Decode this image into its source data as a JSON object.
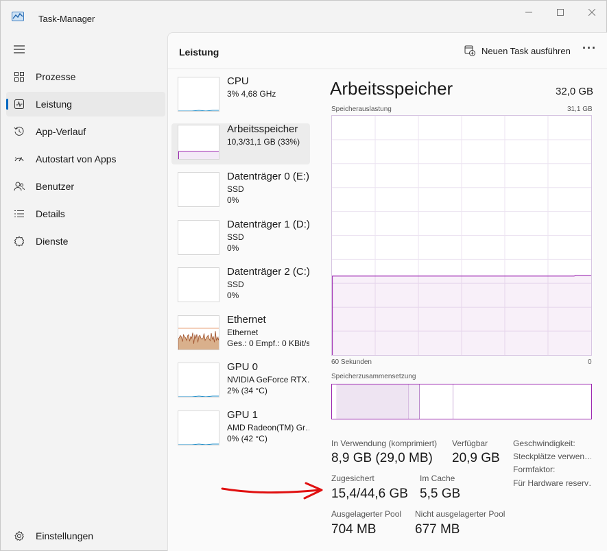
{
  "window": {
    "title": "Task-Manager"
  },
  "sidebar": {
    "items": [
      {
        "label": "Prozesse",
        "icon": "processes-icon"
      },
      {
        "label": "Leistung",
        "icon": "performance-icon",
        "active": true
      },
      {
        "label": "App-Verlauf",
        "icon": "history-icon"
      },
      {
        "label": "Autostart von Apps",
        "icon": "startup-icon"
      },
      {
        "label": "Benutzer",
        "icon": "users-icon"
      },
      {
        "label": "Details",
        "icon": "details-icon"
      },
      {
        "label": "Dienste",
        "icon": "services-icon"
      }
    ],
    "settings": {
      "label": "Einstellungen",
      "icon": "gear-icon"
    }
  },
  "header": {
    "title": "Leistung",
    "run_task": "Neuen Task ausführen",
    "more": "···"
  },
  "devices": [
    {
      "name": "CPU",
      "sub1": "3%  4,68 GHz",
      "sub2": "",
      "graph": "cpu",
      "color": "#1b8bc7"
    },
    {
      "name": "Arbeitsspeicher",
      "sub1": "10,3/31,1 GB (33%)",
      "sub2": "",
      "graph": "memory",
      "color": "#9c27b0",
      "active": true
    },
    {
      "name": "Datenträger 0 (E:)",
      "sub1": "SSD",
      "sub2": "0%",
      "graph": "disk",
      "color": "#4caf50"
    },
    {
      "name": "Datenträger 1 (D:)",
      "sub1": "SSD",
      "sub2": "0%",
      "graph": "disk",
      "color": "#4caf50"
    },
    {
      "name": "Datenträger 2 (C:)",
      "sub1": "SSD",
      "sub2": "0%",
      "graph": "disk",
      "color": "#4caf50"
    },
    {
      "name": "Ethernet",
      "sub1": "Ethernet",
      "sub2": "Ges.: 0 Empf.: 0 KBit/s",
      "graph": "ethernet",
      "color": "#a0522d"
    },
    {
      "name": "GPU 0",
      "sub1": "NVIDIA GeForce RTX…",
      "sub2": "2%  (34 °C)",
      "graph": "gpu",
      "color": "#1b8bc7"
    },
    {
      "name": "GPU 1",
      "sub1": "AMD Radeon(TM) Gr…",
      "sub2": "0%  (42 °C)",
      "graph": "gpu",
      "color": "#1b8bc7"
    }
  ],
  "detail": {
    "title": "Arbeitsspeicher",
    "total": "32,0 GB",
    "usage_label": "Speicherauslastung",
    "usage_max": "31,1 GB",
    "usage_fraction": 0.33,
    "axis_left": "60 Sekunden",
    "axis_right": "0",
    "composition_label": "Speicherzusammensetzung",
    "stats": {
      "in_use_label": "In Verwendung (komprimiert)",
      "in_use_value": "8,9 GB (29,0 MB)",
      "available_label": "Verfügbar",
      "available_value": "20,9 GB",
      "committed_label": "Zugesichert",
      "committed_value": "15,4/44,6 GB",
      "cached_label": "Im Cache",
      "cached_value": "5,5 GB",
      "paged_label": "Ausgelagerter Pool",
      "paged_value": "704 MB",
      "nonpaged_label": "Nicht ausgelagerter Pool",
      "nonpaged_value": "677 MB"
    },
    "right_labels": [
      "Geschwindigkeit:",
      "Steckplätze verwen…",
      "Formfaktor:",
      "Für Hardware reserv…"
    ]
  },
  "colors": {
    "accent": "#0067c0",
    "memory": "#9c27b0",
    "annotation": "#e01010"
  }
}
